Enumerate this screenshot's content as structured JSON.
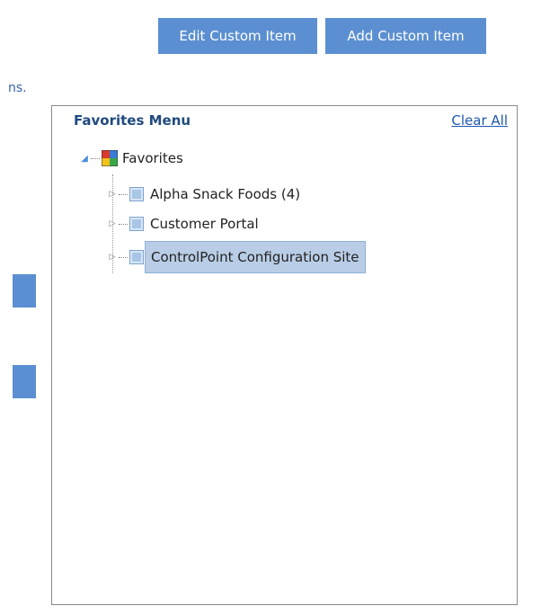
{
  "toolbar": {
    "edit_label": "Edit Custom Item",
    "add_label": "Add Custom Item"
  },
  "clipped_text": "ns.",
  "favorites_panel": {
    "title": "Favorites Menu",
    "clear_all": "Clear All",
    "root": {
      "label": "Favorites",
      "icon": "favorites-puzzle-icon"
    },
    "items": [
      {
        "label": "Alpha Snack Foods (4)",
        "icon": "site-icon",
        "selected": false
      },
      {
        "label": "Customer Portal",
        "icon": "site-icon",
        "selected": false
      },
      {
        "label": "ControlPoint Configuration Site",
        "icon": "site-icon",
        "selected": true
      }
    ]
  },
  "colors": {
    "button_blue": "#5b8fd2",
    "selection_bg": "#b9cde6",
    "title_color": "#1f4a7d",
    "link_color": "#1f57b0"
  }
}
